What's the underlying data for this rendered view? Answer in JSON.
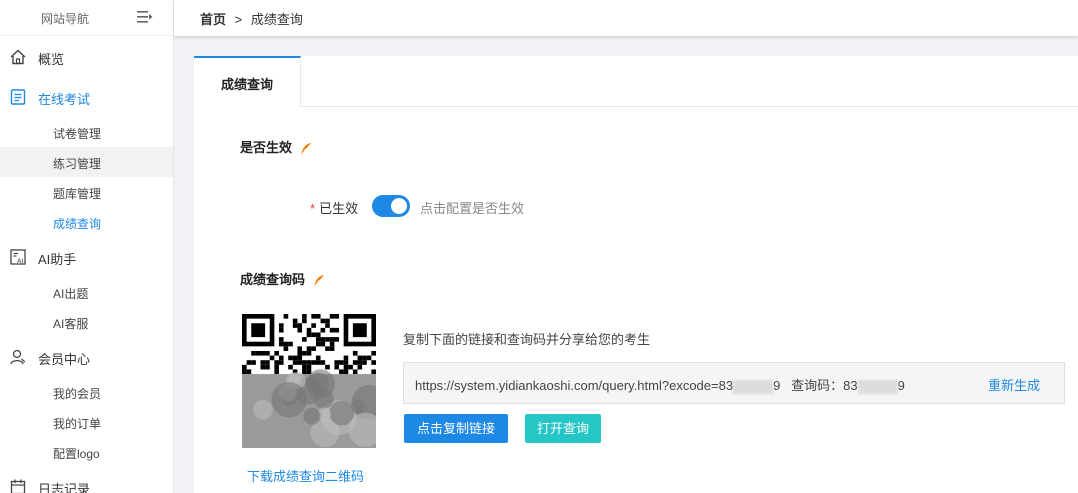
{
  "sidebar": {
    "title": "网站导航",
    "groups": {
      "overview": "概览",
      "exam": "在线考试",
      "ai": "AI助手",
      "member": "会员中心",
      "log": "日志记录"
    },
    "exam_items": [
      "试卷管理",
      "练习管理",
      "题库管理",
      "成绩查询"
    ],
    "ai_items": [
      "AI出题",
      "AI客服"
    ],
    "member_items": [
      "我的会员",
      "我的订单",
      "配置logo"
    ]
  },
  "breadcrumb": {
    "home": "首页",
    "separator": ">",
    "current": "成绩查询"
  },
  "tabs": [
    "成绩查询"
  ],
  "effective": {
    "section_title": "是否生效",
    "required_mark": "*",
    "label": "已生效",
    "enabled": true,
    "hint": "点击配置是否生效"
  },
  "query_code": {
    "section_title": "成绩查询码",
    "share_tip": "复制下面的链接和查询码并分享给您的考生",
    "url_prefix": "https://system.yidiankaoshi.com/query.html?excode=83",
    "url_suffix": "9",
    "code_label": "查询码：83",
    "code_suffix": "9",
    "regenerate": "重新生成",
    "copy_button": "点击复制链接",
    "open_button": "打开查询",
    "download_qr": "下载成绩查询二维码"
  },
  "colors": {
    "accent": "#1e88e5",
    "teal": "#26c6c6",
    "leaf": "#f57c00"
  }
}
